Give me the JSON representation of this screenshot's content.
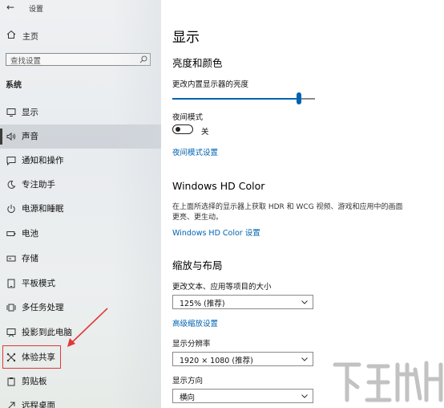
{
  "app": {
    "title": "设置"
  },
  "sidebar": {
    "home_label": "主页",
    "search_placeholder": "查找设置",
    "section_title": "系统",
    "selected_index": 1,
    "items": [
      {
        "label": "显示",
        "icon": "monitor-icon"
      },
      {
        "label": "声音",
        "icon": "speaker-icon"
      },
      {
        "label": "通知和操作",
        "icon": "notification-icon"
      },
      {
        "label": "专注助手",
        "icon": "moon-icon"
      },
      {
        "label": "电源和睡眠",
        "icon": "power-icon"
      },
      {
        "label": "电池",
        "icon": "battery-icon"
      },
      {
        "label": "存储",
        "icon": "storage-icon"
      },
      {
        "label": "平板模式",
        "icon": "tablet-icon"
      },
      {
        "label": "多任务处理",
        "icon": "multitask-icon"
      },
      {
        "label": "投影到此电脑",
        "icon": "project-icon"
      },
      {
        "label": "体验共享",
        "icon": "shared-experience-icon"
      },
      {
        "label": "剪贴板",
        "icon": "clipboard-icon"
      },
      {
        "label": "远程桌面",
        "icon": "remote-desktop-icon"
      }
    ],
    "annotation": {
      "highlighted_item": "体验共享",
      "color": "#e0383b"
    }
  },
  "main": {
    "title": "显示",
    "brightness": {
      "heading": "亮度和颜色",
      "slider_label": "更改内置显示器的亮度",
      "slider_value": 0.89
    },
    "night_light": {
      "label": "夜间模式",
      "toggle_state": "关",
      "settings_link": "夜间模式设置"
    },
    "hd_color": {
      "heading": "Windows HD Color",
      "description": "在上面所选择的显示器上获取 HDR 和 WCG 视频、游戏和应用中的画面更亮、更生动。",
      "link": "Windows HD Color 设置"
    },
    "scale_layout": {
      "heading": "缩放与布局",
      "scale_label": "更改文本、应用等项目的大小",
      "scale_value": "125% (推荐)",
      "advanced_link": "高级缩放设置",
      "resolution_label": "显示分辨率",
      "resolution_value": "1920 × 1080 (推荐)",
      "orientation_label": "显示方向",
      "orientation_value": "横向"
    }
  },
  "colors": {
    "accent": "#0063b1",
    "sidebar_bg": "#eceef0"
  }
}
